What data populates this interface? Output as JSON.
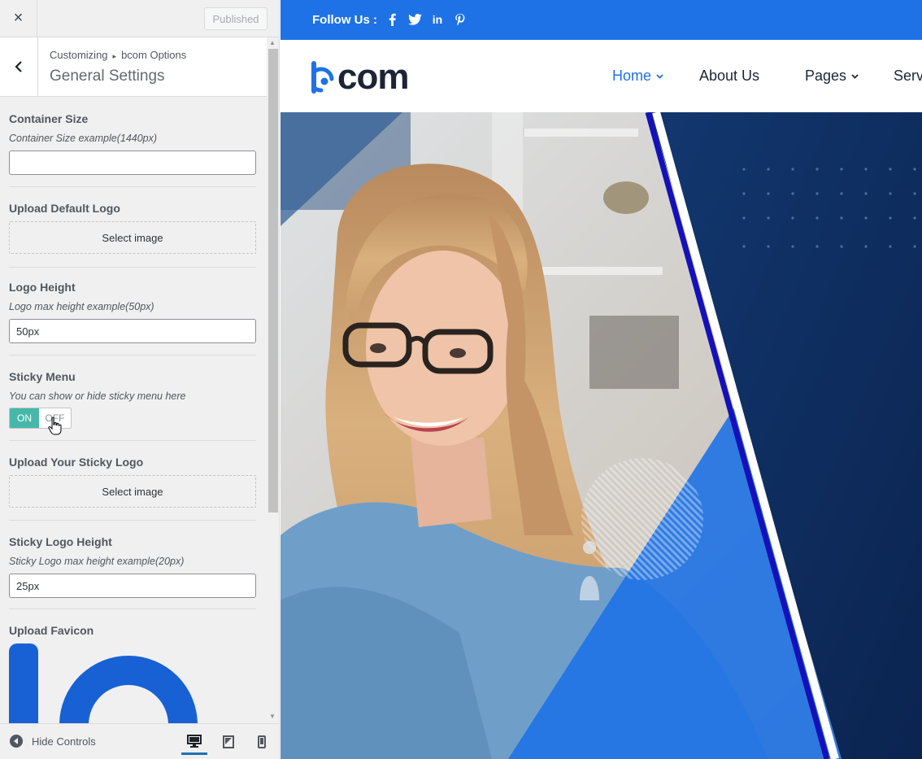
{
  "customizer": {
    "close_label": "×",
    "publish_label": "Published",
    "breadcrumb": {
      "root": "Customizing",
      "parent": "bcom Options"
    },
    "section_title": "General Settings",
    "controls": {
      "container_size": {
        "title": "Container Size",
        "description": "Container Size example(1440px)",
        "value": ""
      },
      "default_logo": {
        "title": "Upload Default Logo",
        "button": "Select image"
      },
      "logo_height": {
        "title": "Logo Height",
        "description": "Logo max height example(50px)",
        "value": "50px"
      },
      "sticky_menu": {
        "title": "Sticky Menu",
        "description": "You can show or hide sticky menu here",
        "on_label": "ON",
        "off_label": "OFF",
        "state": "on"
      },
      "sticky_logo": {
        "title": "Upload Your Sticky Logo",
        "button": "Select image"
      },
      "sticky_logo_height": {
        "title": "Sticky Logo Height",
        "description": "Sticky Logo max height example(20px)",
        "value": "25px"
      },
      "favicon": {
        "title": "Upload Favicon"
      }
    },
    "footer": {
      "hide_controls_label": "Hide Controls",
      "devices": [
        "desktop-icon",
        "tablet-icon",
        "mobile-icon"
      ],
      "active_device": "desktop"
    }
  },
  "site": {
    "follow_label": "Follow Us :",
    "social_icons": [
      "facebook-icon",
      "twitter-icon",
      "linkedin-icon",
      "pinterest-icon"
    ],
    "logo_text": "com",
    "nav": {
      "home": "Home",
      "about": "About Us",
      "pages": "Pages",
      "services": "Serv"
    }
  },
  "colors": {
    "brand_blue": "#1e72e6",
    "dark_navy": "#0d2a57",
    "toggle_on": "#46b8aa",
    "text_dark": "#1b2537"
  }
}
